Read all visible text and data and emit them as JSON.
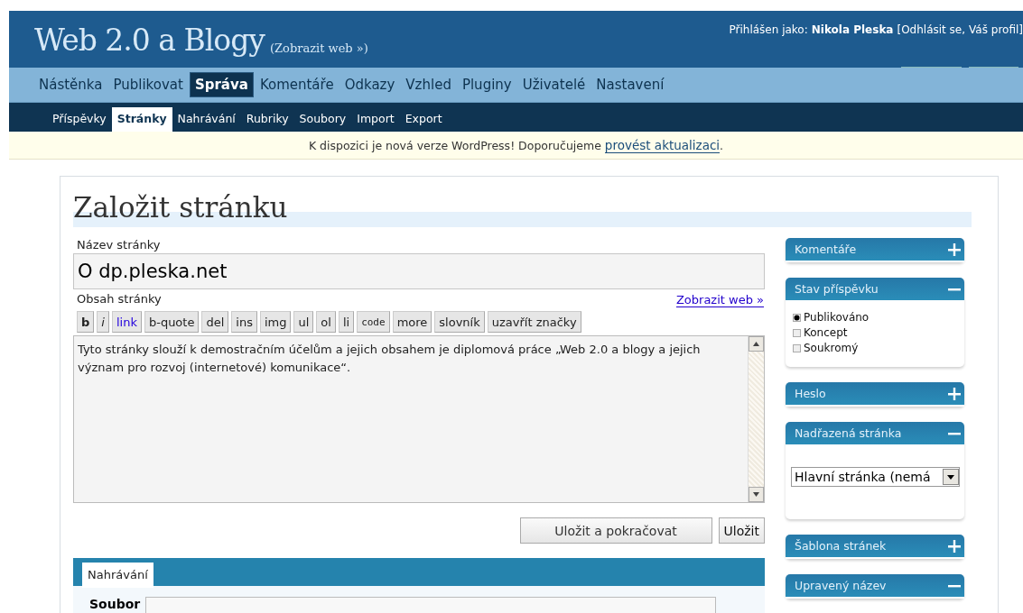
{
  "header": {
    "site_title": "Web 2.0 a Blogy",
    "view_site_link": "(Zobrazit web »)",
    "greeting": "Přihlášen jako:",
    "user_name": "Nikola Pleska",
    "open": "[",
    "links": [
      "Odhlásit se",
      "Váš profil"
    ],
    "separator": ",",
    "close": "]"
  },
  "menu": [
    {
      "label": "Nástěnka",
      "selected": false
    },
    {
      "label": "Publikovat",
      "selected": false
    },
    {
      "label": "Správa",
      "selected": true
    },
    {
      "label": "Komentáře",
      "selected": false
    },
    {
      "label": "Odkazy",
      "selected": false
    },
    {
      "label": "Vzhled",
      "selected": false
    },
    {
      "label": "Pluginy",
      "selected": false
    },
    {
      "label": "Uživatelé",
      "selected": false
    },
    {
      "label": "Nastavení",
      "selected": false
    }
  ],
  "submenu": [
    {
      "label": "Příspěvky",
      "selected": false
    },
    {
      "label": "Stránky",
      "selected": true
    },
    {
      "label": "Nahrávání",
      "selected": false
    },
    {
      "label": "Rubriky",
      "selected": false
    },
    {
      "label": "Soubory",
      "selected": false
    },
    {
      "label": "Import",
      "selected": false
    },
    {
      "label": "Export",
      "selected": false
    }
  ],
  "notice": {
    "text": "K dispozici je nová verze WordPress! Doporučujeme",
    "link": "provést aktualizaci",
    "end": "."
  },
  "page_title": "Založit stránku",
  "editor": {
    "title_label": "Název stránky",
    "title_value": "O dp.pleska.net",
    "content_label": "Obsah stránky",
    "view_link": "Zobrazit web »",
    "toolbar": [
      {
        "label": "b",
        "kind": "bold"
      },
      {
        "label": "i",
        "kind": "italic"
      },
      {
        "label": "link",
        "kind": "link"
      },
      {
        "label": "b-quote",
        "kind": "plain"
      },
      {
        "label": "del",
        "kind": "plain"
      },
      {
        "label": "ins",
        "kind": "plain"
      },
      {
        "label": "img",
        "kind": "plain"
      },
      {
        "label": "ul",
        "kind": "plain"
      },
      {
        "label": "ol",
        "kind": "plain"
      },
      {
        "label": "li",
        "kind": "plain"
      },
      {
        "label": "code",
        "kind": "code"
      },
      {
        "label": "more",
        "kind": "plain"
      },
      {
        "label": "slovník",
        "kind": "plain"
      },
      {
        "label": "uzavřít značky",
        "kind": "plain"
      }
    ],
    "content": "Tyto stránky slouží k demostračním účelům a jejich obsahem je diplomová práce „Web 2.0 a blogy a jejich význam pro rozvoj (internetové) komunikace“.",
    "buttons": [
      {
        "label": "Uložit a pokračovat",
        "kind": "secondary"
      },
      {
        "label": "Uložit",
        "kind": "primary"
      }
    ]
  },
  "upload": {
    "tabs": [
      {
        "label": "Nahrávání",
        "selected": true
      }
    ],
    "file_label": "Soubor"
  },
  "sidebar": [
    {
      "title": "Komentáře",
      "expanded": false
    },
    {
      "title": "Stav příspěvku",
      "expanded": true,
      "kind": "radios",
      "options": [
        {
          "label": "Publikováno",
          "selected": true
        },
        {
          "label": "Koncept",
          "selected": false
        },
        {
          "label": "Soukromý",
          "selected": false
        }
      ]
    },
    {
      "title": "Heslo",
      "expanded": false
    },
    {
      "title": "Nadřazená stránka",
      "expanded": true,
      "kind": "select",
      "value": "Hlavní stránka (nemá"
    },
    {
      "title": "Šablona stránek",
      "expanded": false
    },
    {
      "title": "Upravený název",
      "expanded": true
    }
  ]
}
